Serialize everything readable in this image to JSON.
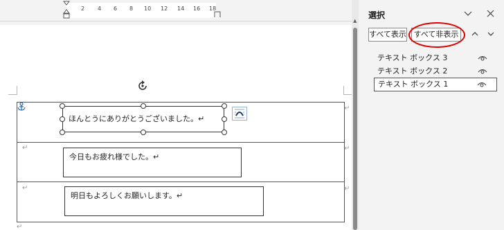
{
  "ruler": {
    "numbers": [
      "2",
      "4",
      "6",
      "8",
      "10",
      "12",
      "14",
      "16",
      "18"
    ]
  },
  "document": {
    "text_boxes": [
      {
        "text": "ほんとうにありがとうございました。↵"
      },
      {
        "text": "今日もお疲れ様でした。↵"
      },
      {
        "text": "明日もよろしくお願いします。↵"
      }
    ],
    "paragraph_mark": "↵"
  },
  "panel": {
    "title": "選択",
    "show_all": "すべて表示",
    "hide_all": "すべて非表示",
    "items": [
      {
        "label": "テキスト ボックス 3"
      },
      {
        "label": "テキスト ボックス 2"
      },
      {
        "label": "テキスト ボックス 1"
      }
    ]
  },
  "colors": {
    "highlight": "#e00000",
    "ui_bg": "#f3f3f3"
  }
}
